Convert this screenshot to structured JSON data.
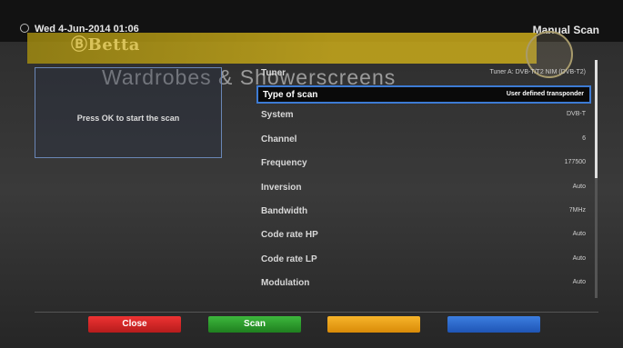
{
  "header": {
    "datetime": "Wed  4-Jun-2014 01:06",
    "title": "Manual Scan"
  },
  "branding": {
    "logo_text": "Betta",
    "tagline": "Wardrobes & Showerscreens"
  },
  "info": {
    "message": "Press OK to start the scan"
  },
  "settings": [
    {
      "label": "Tuner",
      "value": "Tuner A: DVB-T/T2 NIM (DVB-T2)"
    },
    {
      "label": "Type of scan",
      "value": "User defined transponder"
    },
    {
      "label": "System",
      "value": "DVB-T"
    },
    {
      "label": "Channel",
      "value": "6"
    },
    {
      "label": "Frequency",
      "value": "177500"
    },
    {
      "label": "Inversion",
      "value": "Auto"
    },
    {
      "label": "Bandwidth",
      "value": "7MHz"
    },
    {
      "label": "Code rate HP",
      "value": "Auto"
    },
    {
      "label": "Code rate LP",
      "value": "Auto"
    },
    {
      "label": "Modulation",
      "value": "Auto"
    }
  ],
  "buttons": {
    "red": "Close",
    "green": "Scan",
    "yellow": "",
    "blue": ""
  },
  "colors": {
    "selection": "#3d7bd4",
    "red": "#cc2222",
    "green": "#2a9a2a",
    "yellow": "#f0a020",
    "blue": "#2d6bd0"
  }
}
